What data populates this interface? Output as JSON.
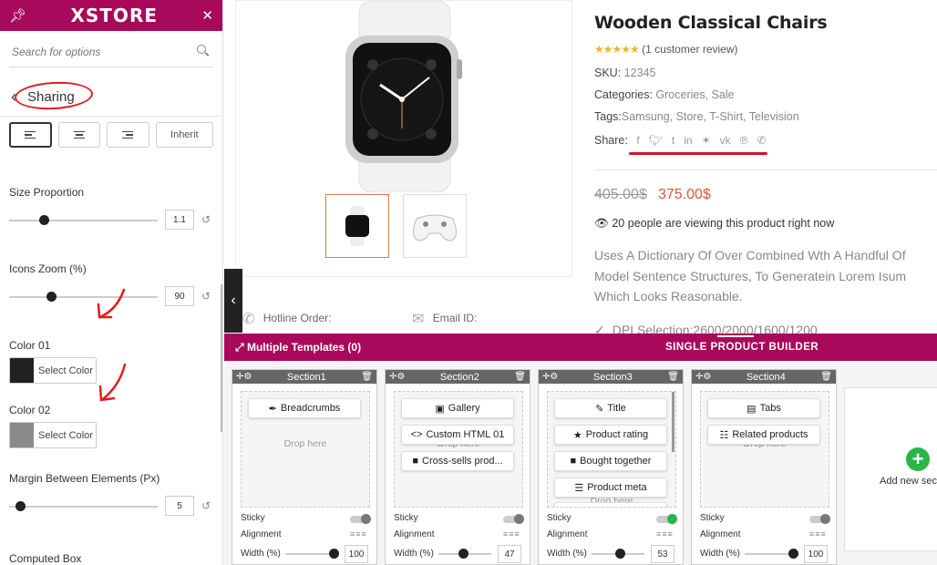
{
  "sidebar": {
    "logo": "XSTORE",
    "search_placeholder": "Search for options",
    "section_title": "Sharing",
    "align_inherit": "Inherit",
    "size_proportion": {
      "label": "Size Proportion",
      "value": "1.1"
    },
    "icons_zoom": {
      "label": "Icons Zoom (%)",
      "value": "90"
    },
    "color01": {
      "label": "Color 01",
      "button": "Select Color",
      "swatch": "#222222"
    },
    "color02": {
      "label": "Color 02",
      "button": "Select Color",
      "swatch": "#8a8a8a"
    },
    "margin": {
      "label": "Margin Between Elements (Px)",
      "value": "5"
    },
    "computed_box": "Computed Box"
  },
  "product": {
    "title": "Wooden Classical Chairs",
    "review": "(1 customer review)",
    "sku_label": "SKU:",
    "sku": "12345",
    "categories_label": "Categories:",
    "categories": "Groceries, Sale",
    "tags_label": "Tags:",
    "tags": "Samsung, Store, T-Shirt, Television",
    "share_label": "Share:",
    "old_price": "405.00$",
    "new_price": "375.00$",
    "viewing": "20 people are viewing this product right now",
    "description": "Uses A Dictionary Of Over Combined Wth A Handful Of Model Sentence Structures, To Generatein Lorem Isum Which Looks Reasonable.",
    "dpi": "DPI Selection:2600/2000/1600/1200",
    "hotline_label": "Hotline Order:",
    "email_label": "Email ID:"
  },
  "builder": {
    "multiple_templates": "Multiple Templates (0)",
    "title": "SINGLE PRODUCT BUILDER",
    "drop_here": "Drop here",
    "sticky": "Sticky",
    "alignment": "Alignment",
    "width_label": "Width (%)",
    "add_new": "Add new sec",
    "sections": [
      {
        "name": "Section1",
        "items": [
          "Breadcrumbs"
        ],
        "width": "100",
        "sticky_on": false
      },
      {
        "name": "Section2",
        "items": [
          "Gallery",
          "Custom HTML 01",
          "Cross-sells prod..."
        ],
        "width": "47",
        "sticky_on": false
      },
      {
        "name": "Section3",
        "items": [
          "Title",
          "Product rating",
          "Bought together",
          "Product meta"
        ],
        "width": "53",
        "sticky_on": true
      },
      {
        "name": "Section4",
        "items": [
          "Tabs",
          "Related products"
        ],
        "width": "100",
        "sticky_on": false
      }
    ]
  },
  "colors": {
    "brand": "#a8095a",
    "price": "#e0553b",
    "accent_green": "#2ab54a",
    "annotation_red": "#e31b1b"
  }
}
